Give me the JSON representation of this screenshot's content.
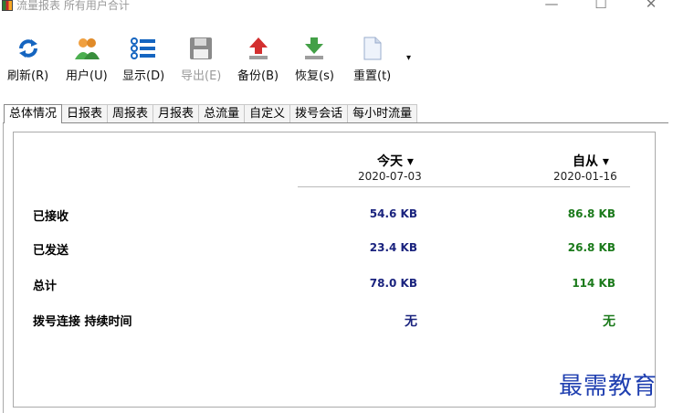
{
  "window": {
    "title": "流量报表 所有用户合计",
    "controls": {
      "minimize": "—",
      "maximize": "☐",
      "close": "✕"
    }
  },
  "toolbar": {
    "refresh_label": "刷新(R)",
    "users_label": "用户(U)",
    "display_label": "显示(D)",
    "export_label": "导出(E)",
    "backup_label": "备份(B)",
    "restore_label": "恢复(s)",
    "reset_label": "重置(t)",
    "more_label": "▾"
  },
  "tabs": [
    "总体情况",
    "日报表",
    "周报表",
    "月报表",
    "总流量",
    "自定义",
    "拨号会话",
    "每小时流量"
  ],
  "summary": {
    "columns": [
      {
        "heading": "今天 ▾",
        "date": "2020-07-03"
      },
      {
        "heading": "自从 ▾",
        "date": "2020-01-16"
      }
    ],
    "rows": [
      {
        "label": "已接收",
        "today": "54.6 KB",
        "since": "86.8 KB"
      },
      {
        "label": "已发送",
        "today": "23.4 KB",
        "since": "26.8 KB"
      },
      {
        "label": "总计",
        "today": "78.0 KB",
        "since": "114 KB"
      },
      {
        "label": "拨号连接 持续时间",
        "today": "无",
        "since": "无"
      }
    ]
  },
  "watermark": "最需教育",
  "colors": {
    "today_values": "#1a237e",
    "since_values": "#1b7a1b",
    "watermark": "#1f3fb0"
  }
}
